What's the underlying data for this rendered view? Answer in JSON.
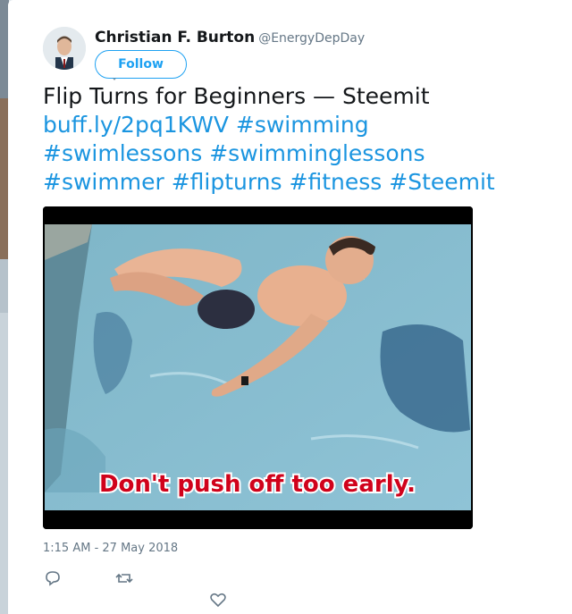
{
  "tweet": {
    "author_name": "Christian F. Burton",
    "author_handle": "@EnergyDepDay",
    "follow_label": "Follow",
    "text_title": "Flip Turns for Beginners — Steemit",
    "link": "buff.ly/2pq1KWV",
    "hashtags": [
      "#swimming",
      "#swimlessons",
      "#swimminglessons",
      "#swimmer",
      "#flipturns",
      "#fitness",
      "#Steemit"
    ],
    "video_caption": "Don't push off too early.",
    "timestamp": "1:15 AM - 27 May 2018"
  },
  "icons": {
    "reply": "reply-icon",
    "retweet": "retweet-icon",
    "like": "heart-icon"
  },
  "colors": {
    "accent": "#1da1f2",
    "link": "#1b95e0",
    "muted": "#657786",
    "caption_text": "#d0021b"
  }
}
